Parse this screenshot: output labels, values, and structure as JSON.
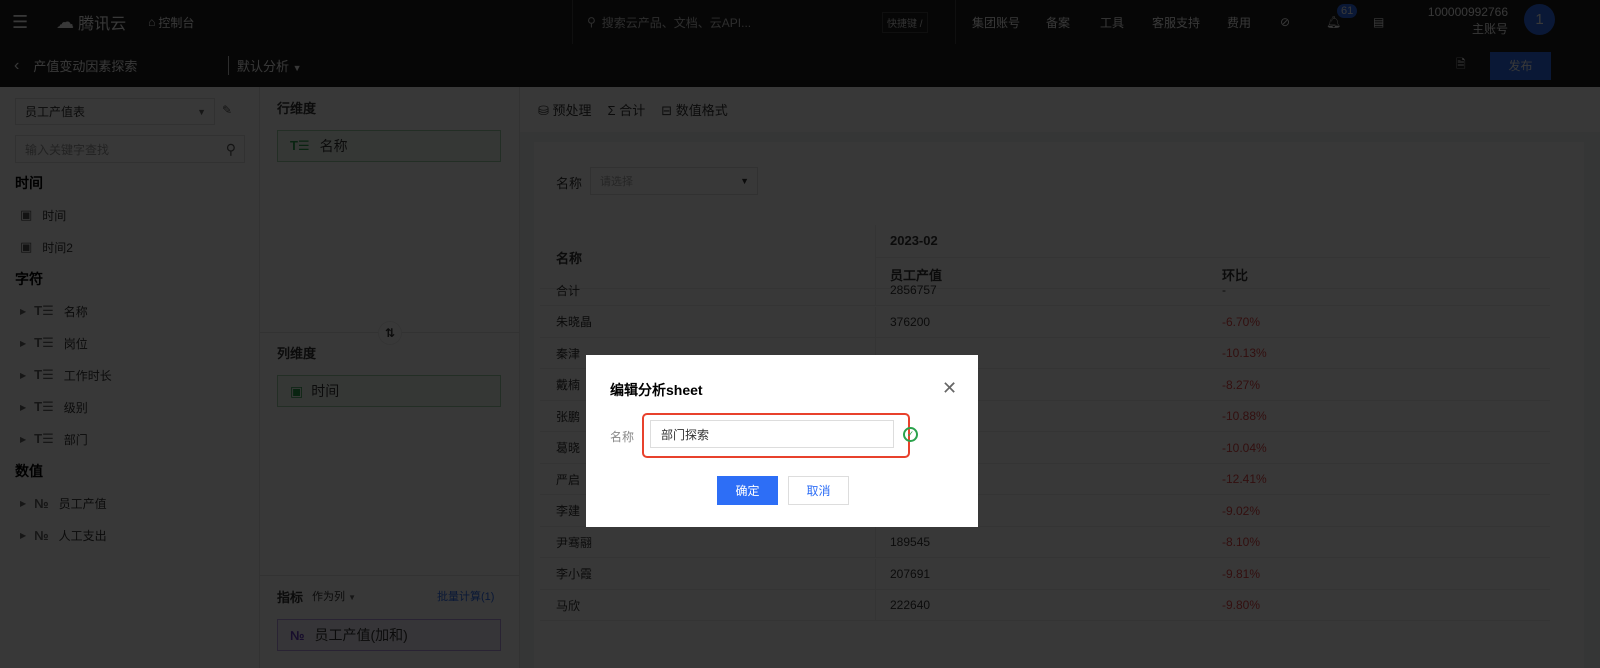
{
  "topbar": {
    "brand": "腾讯云",
    "console": "控制台",
    "search_placeholder": "搜索云产品、文档、云API...",
    "shortcut": "快捷键 /",
    "nav": [
      "集团账号",
      "备案",
      "工具",
      "客服支持",
      "费用"
    ],
    "notification_count": "61",
    "account_id": "100000992766",
    "account_type": "主账号",
    "avatar": "1"
  },
  "subbar": {
    "title": "产值变动因素探索",
    "analysis": "默认分析",
    "publish": "发布"
  },
  "sidebar": {
    "table_select": "员工产值表",
    "search_placeholder": "输入关键字查找",
    "groups": [
      {
        "title": "时间",
        "items": [
          {
            "label": "时间",
            "icon": "calendar-icon"
          },
          {
            "label": "时间2",
            "icon": "calendar-icon"
          }
        ]
      },
      {
        "title": "字符",
        "items": [
          {
            "label": "名称",
            "icon": "text-icon"
          },
          {
            "label": "岗位",
            "icon": "text-icon"
          },
          {
            "label": "工作时长",
            "icon": "text-icon"
          },
          {
            "label": "级别",
            "icon": "text-icon"
          },
          {
            "label": "部门",
            "icon": "text-icon"
          }
        ]
      },
      {
        "title": "数值",
        "items": [
          {
            "label": "员工产值",
            "icon": "number-icon"
          },
          {
            "label": "人工支出",
            "icon": "number-icon"
          }
        ]
      }
    ]
  },
  "config": {
    "row_title": "行维度",
    "row_chip": "名称",
    "col_title": "列维度",
    "col_chip": "时间",
    "metric_title": "指标",
    "metric_mode": "作为列",
    "batch": "批量计算(1)",
    "metric_chip": "员工产值(加和)"
  },
  "toolbar": {
    "preprocess": "预处理",
    "total": "合计",
    "format": "数值格式"
  },
  "filter": {
    "label": "名称",
    "placeholder": "请选择"
  },
  "table": {
    "h_name": "名称",
    "h_period": "2023-02",
    "h_value": "员工产值",
    "h_ratio": "环比",
    "rows": [
      [
        "合计",
        "2856757",
        "-"
      ],
      [
        "朱晓晶",
        "376200",
        "-6.70%"
      ],
      [
        "秦津",
        "",
        "-10.13%"
      ],
      [
        "戴楠",
        "",
        "-8.27%"
      ],
      [
        "张鹏",
        "",
        "-10.88%"
      ],
      [
        "葛晓",
        "",
        "-10.04%"
      ],
      [
        "严启",
        "",
        "-12.41%"
      ],
      [
        "李建",
        "",
        "-9.02%"
      ],
      [
        "尹骞翮",
        "189545",
        "-8.10%"
      ],
      [
        "李小霞",
        "207691",
        "-9.81%"
      ],
      [
        "马欣",
        "222640",
        "-9.80%"
      ]
    ]
  },
  "modal": {
    "title": "编辑分析sheet",
    "label": "名称",
    "value": "部门探索",
    "ok": "确定",
    "cancel": "取消"
  },
  "colors": {
    "primary": "#2d6ef6",
    "negative": "#e54545",
    "highlight": "#e8412c",
    "success": "#2ba24c"
  }
}
